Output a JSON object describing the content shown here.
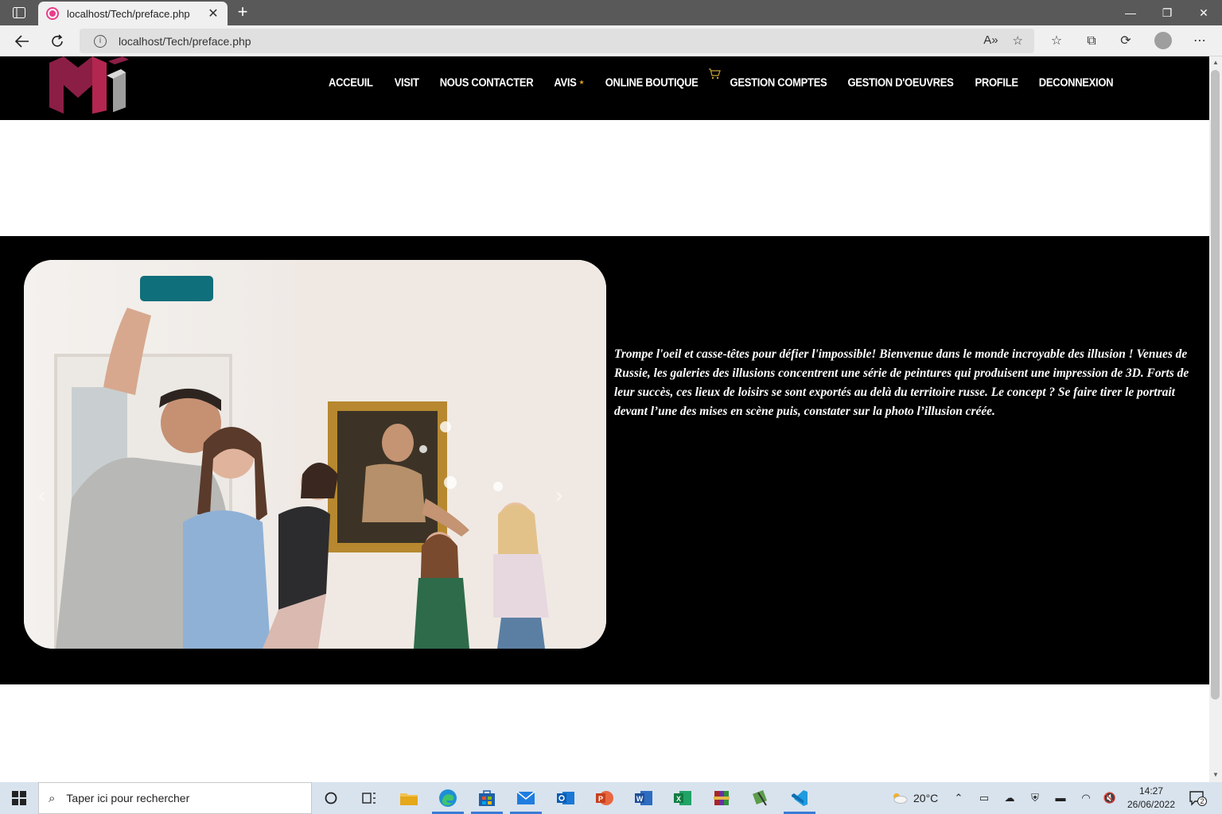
{
  "browser": {
    "tab_title": "localhost/Tech/preface.php",
    "url": "localhost/Tech/preface.php"
  },
  "site": {
    "nav": [
      {
        "label": "ACCEUIL"
      },
      {
        "label": "VISIT"
      },
      {
        "label": "NOUS CONTACTER"
      },
      {
        "label": "AVIS"
      },
      {
        "label": "ONLINE BOUTIQUE"
      },
      {
        "label": "GESTION COMPTES"
      },
      {
        "label": "GESTION D'OEUVRES"
      },
      {
        "label": "PROFILE"
      },
      {
        "label": "DECONNEXION"
      }
    ],
    "hero_text": "Trompe l'oeil et casse-têtes pour défier l'impossible! Bienvenue dans le monde incroyable des illusion ! Venues de Russie, les galeries des illusions concentrent une série de peintures qui produisent une impression de 3D. Forts de leur succès, ces lieux de loisirs se sont exportés au delà du territoire russe. Le concept ? Se faire tirer le portrait devant l’une des mises en scène puis, constater sur la photo l’illusion créée."
  },
  "taskbar": {
    "search_placeholder": "Taper ici pour rechercher",
    "temperature": "20°C",
    "time": "14:27",
    "date": "26/06/2022",
    "notification_count": "2"
  },
  "colors": {
    "header_bg": "#000000",
    "logo_primary": "#8b1e45",
    "logo_secondary": "#c8c8c8"
  }
}
